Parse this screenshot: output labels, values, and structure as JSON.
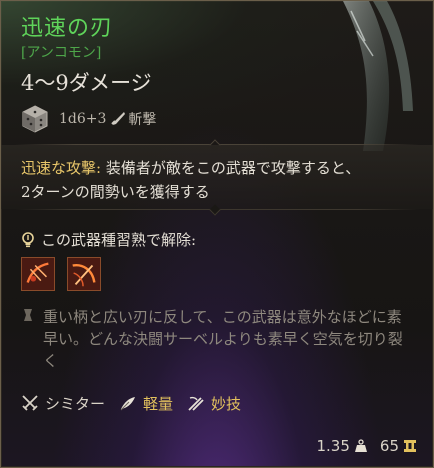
{
  "item": {
    "name": "迅速の刃",
    "rarity": "[アンコモン]",
    "damage": "4〜9ダメージ",
    "dice": "1d6+3",
    "damage_type": "斬撃"
  },
  "passive": {
    "name": "迅速な攻撃:",
    "line1_rest": " 装備者が敵をこの武器で攻撃すると、",
    "line2": "2ターンの間勢いを獲得する"
  },
  "proficiency": {
    "label": "この武器種習熟で解除:"
  },
  "flavor": "重い柄と広い刃に反して、この武器は意外なほどに素早い。どんな決闘サーベルよりも素早く空気を切り裂く",
  "properties": [
    {
      "label": "シミター",
      "icon": "crossed-swords-icon"
    },
    {
      "label": "軽量",
      "icon": "feather-icon"
    },
    {
      "label": "妙技",
      "icon": "finesse-icon"
    }
  ],
  "footer": {
    "weight": "1.35",
    "value": "65"
  },
  "colors": {
    "rarity_green": "#5fd45a",
    "passive_gold": "#e8c66a",
    "border": "#6b5f4a"
  }
}
